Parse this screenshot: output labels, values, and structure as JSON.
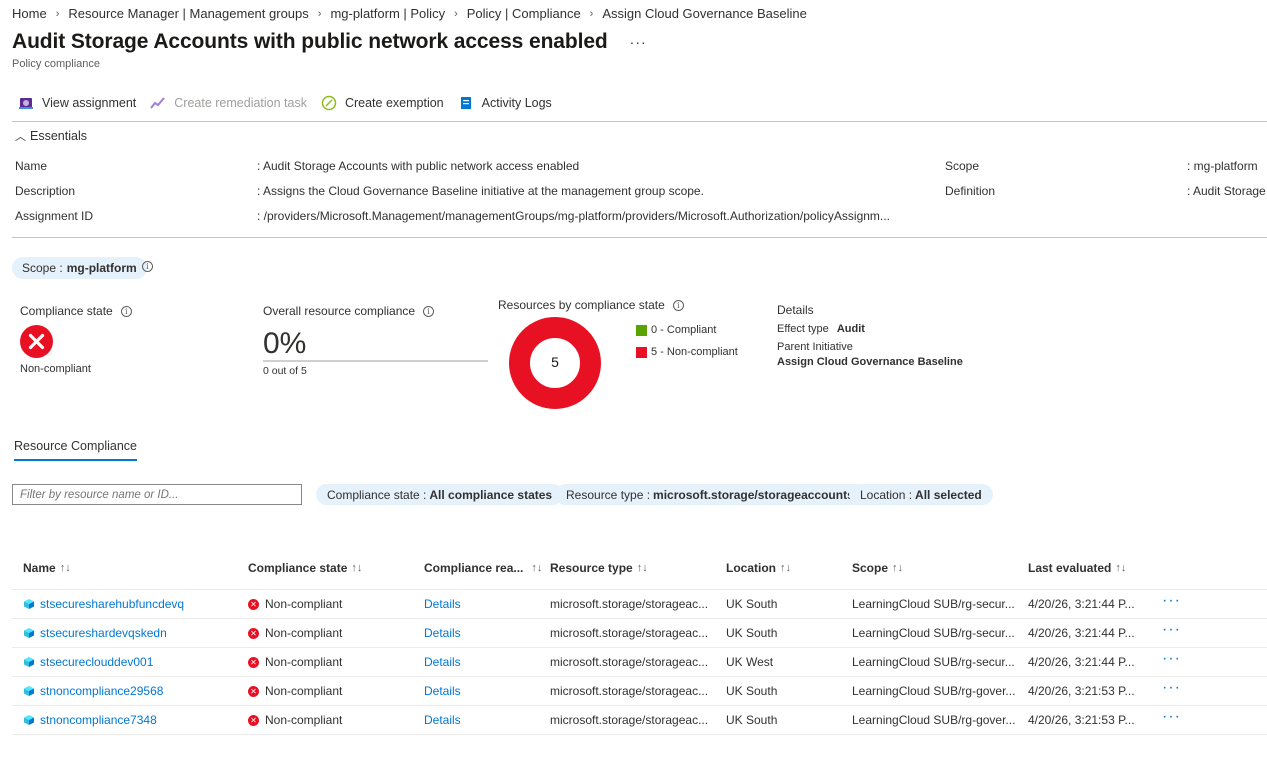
{
  "breadcrumb": [
    "Home",
    "Resource Manager | Management groups",
    "mg-platform | Policy",
    "Policy | Compliance",
    "Assign Cloud Governance Baseline"
  ],
  "page": {
    "title": "Audit Storage Accounts with public network access enabled",
    "subtitle": "Policy compliance",
    "more": "···"
  },
  "toolbar": {
    "view_assignment": "View assignment",
    "create_remediation": "Create remediation task",
    "create_exemption": "Create exemption",
    "activity_logs": "Activity Logs"
  },
  "essentials": {
    "heading": "Essentials",
    "name_label": "Name",
    "name_value": ": Audit Storage Accounts with public network access enabled",
    "description_label": "Description",
    "description_value": ": Assigns the Cloud Governance Baseline initiative at the management group scope.",
    "assignment_id_label": "Assignment ID",
    "assignment_id_value": ": /providers/Microsoft.Management/managementGroups/mg-platform/providers/Microsoft.Authorization/policyAssignm...",
    "scope_label": "Scope",
    "scope_value": ": mg-platform",
    "definition_label": "Definition",
    "definition_value": ": Audit Storage"
  },
  "scope_pill": {
    "label": "Scope :",
    "value": "mg-platform"
  },
  "summary": {
    "compliance_state_label": "Compliance state",
    "compliance_state_value": "Non-compliant",
    "overall_label": "Overall resource compliance",
    "overall_percent": "0%",
    "overall_fraction": "0 out of 5",
    "overall_progress": 0,
    "by_state_label": "Resources by compliance state",
    "donut_total": "5",
    "legend_compliant": "0 - Compliant",
    "legend_noncompliant": "5 - Non-compliant",
    "details_title": "Details",
    "effect_label": "Effect type",
    "effect_value": "Audit",
    "parent_label": "Parent Initiative",
    "parent_value": "Assign Cloud Governance Baseline"
  },
  "chart_data": {
    "type": "pie",
    "categories": [
      "Compliant",
      "Non-compliant"
    ],
    "values": [
      0,
      5
    ],
    "colors": [
      "#57a300",
      "#e81123"
    ]
  },
  "tab": "Resource Compliance",
  "filters": {
    "search_placeholder": "Filter by resource name or ID...",
    "compliance_label": "Compliance state :",
    "compliance_value": "All compliance states",
    "type_label": "Resource type :",
    "type_value": "microsoft.storage/storageaccounts",
    "location_label": "Location :",
    "location_value": "All selected"
  },
  "table": {
    "headers": [
      "Name",
      "Compliance state",
      "Compliance rea...",
      "Resource type",
      "Location",
      "Scope",
      "Last evaluated"
    ],
    "rows": [
      {
        "name": "stsecuresharehubfuncdevq",
        "state": "Non-compliant",
        "reason": "Details",
        "type": "microsoft.storage/storageac...",
        "location": "UK South",
        "scope": "LearningCloud SUB/rg-secur...",
        "evaluated": "4/20/26, 3:21:44 P..."
      },
      {
        "name": "stsecureshardevqskedn",
        "state": "Non-compliant",
        "reason": "Details",
        "type": "microsoft.storage/storageac...",
        "location": "UK South",
        "scope": "LearningCloud SUB/rg-secur...",
        "evaluated": "4/20/26, 3:21:44 P..."
      },
      {
        "name": "stsecureclouddev001",
        "state": "Non-compliant",
        "reason": "Details",
        "type": "microsoft.storage/storageac...",
        "location": "UK West",
        "scope": "LearningCloud SUB/rg-secur...",
        "evaluated": "4/20/26, 3:21:44 P..."
      },
      {
        "name": "stnoncompliance29568",
        "state": "Non-compliant",
        "reason": "Details",
        "type": "microsoft.storage/storageac...",
        "location": "UK South",
        "scope": "LearningCloud SUB/rg-gover...",
        "evaluated": "4/20/26, 3:21:53 P..."
      },
      {
        "name": "stnoncompliance7348",
        "state": "Non-compliant",
        "reason": "Details",
        "type": "microsoft.storage/storageac...",
        "location": "UK South",
        "scope": "LearningCloud SUB/rg-gover...",
        "evaluated": "4/20/26, 3:21:53 P..."
      }
    ],
    "more": "···"
  }
}
